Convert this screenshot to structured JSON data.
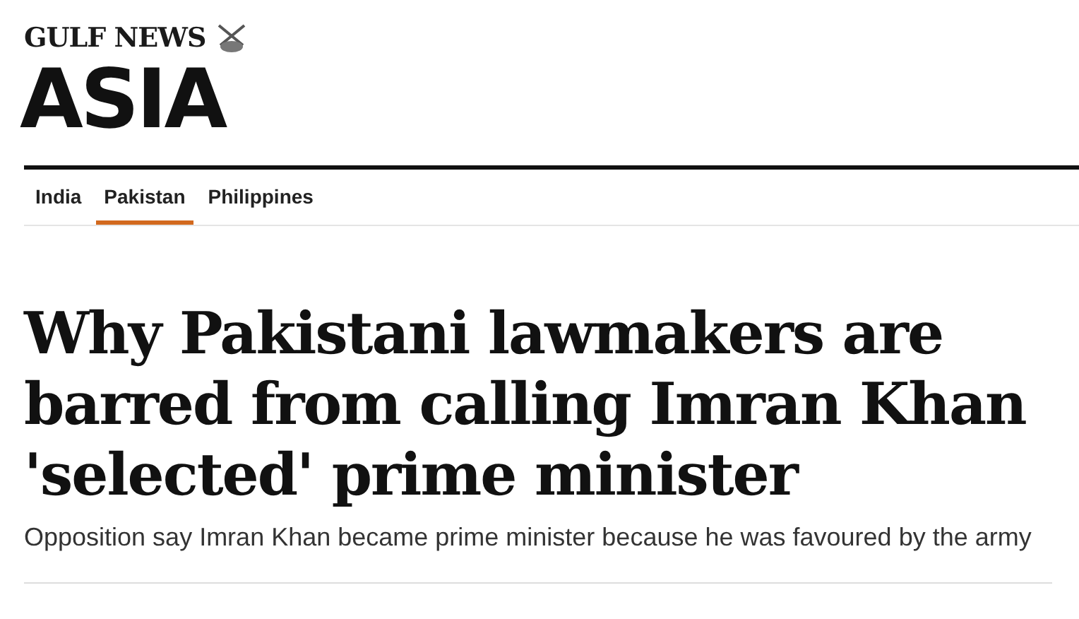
{
  "brand": "GULF NEWS",
  "section": "ASIA",
  "tabs": [
    {
      "label": "India",
      "selected": false
    },
    {
      "label": "Pakistan",
      "selected": true
    },
    {
      "label": "Philippines",
      "selected": false
    }
  ],
  "headline": "Why Pakistani lawmakers are barred from calling Imran Khan 'selected' prime minister",
  "summary": "Opposition say Imran Khan became prime minister because he was favoured by the army"
}
